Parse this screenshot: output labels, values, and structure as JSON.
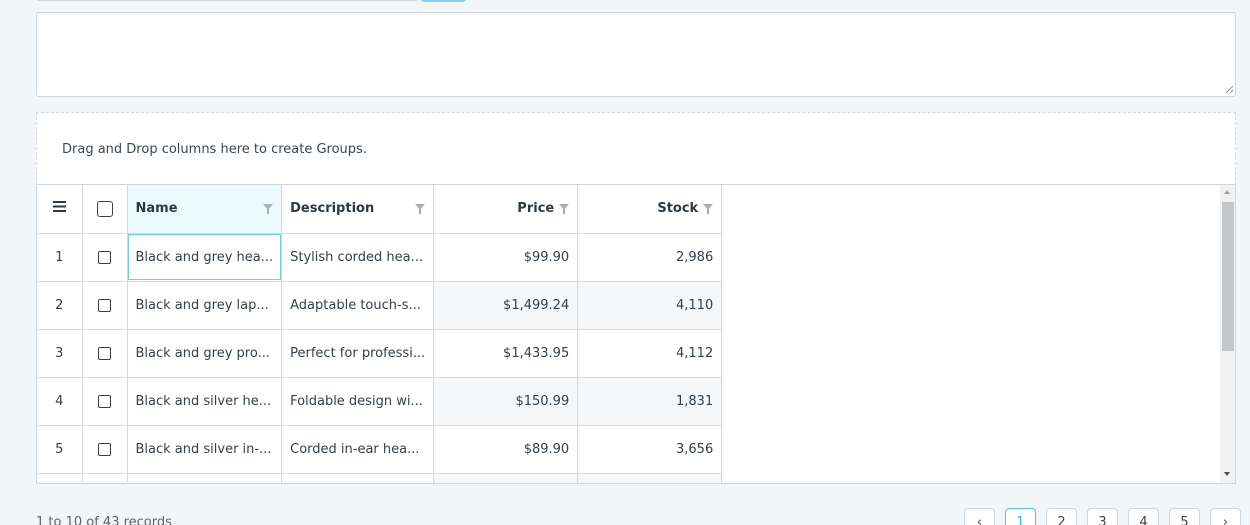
{
  "group_panel": {
    "text": "Drag and Drop columns here to create Groups."
  },
  "grid": {
    "columns": [
      {
        "label": "Name"
      },
      {
        "label": "Description"
      },
      {
        "label": "Price"
      },
      {
        "label": "Stock"
      }
    ],
    "rows": [
      {
        "index": "1",
        "name": "Black and grey hea...",
        "description": "Stylish corded hea...",
        "price": "$99.90",
        "stock": "2,986"
      },
      {
        "index": "2",
        "name": "Black and grey lap...",
        "description": "Adaptable touch-s...",
        "price": "$1,499.24",
        "stock": "4,110"
      },
      {
        "index": "3",
        "name": "Black and grey pro...",
        "description": "Perfect for professi...",
        "price": "$1,433.95",
        "stock": "4,112"
      },
      {
        "index": "4",
        "name": "Black and silver he...",
        "description": "Foldable design wi...",
        "price": "$150.99",
        "stock": "1,831"
      },
      {
        "index": "5",
        "name": "Black and silver in-...",
        "description": "Corded in-ear hea...",
        "price": "$89.90",
        "stock": "3,656"
      }
    ]
  },
  "footer": {
    "records_text": "1 to 10 of 43 records",
    "pages": [
      "1",
      "2",
      "3",
      "4",
      "5"
    ],
    "prev_label": "‹",
    "next_label": "›",
    "active_page": "1"
  },
  "colors": {
    "accent": "#2fb3df",
    "accent_border": "#4cc3e6",
    "header_active_bg": "#ecf9fd"
  }
}
